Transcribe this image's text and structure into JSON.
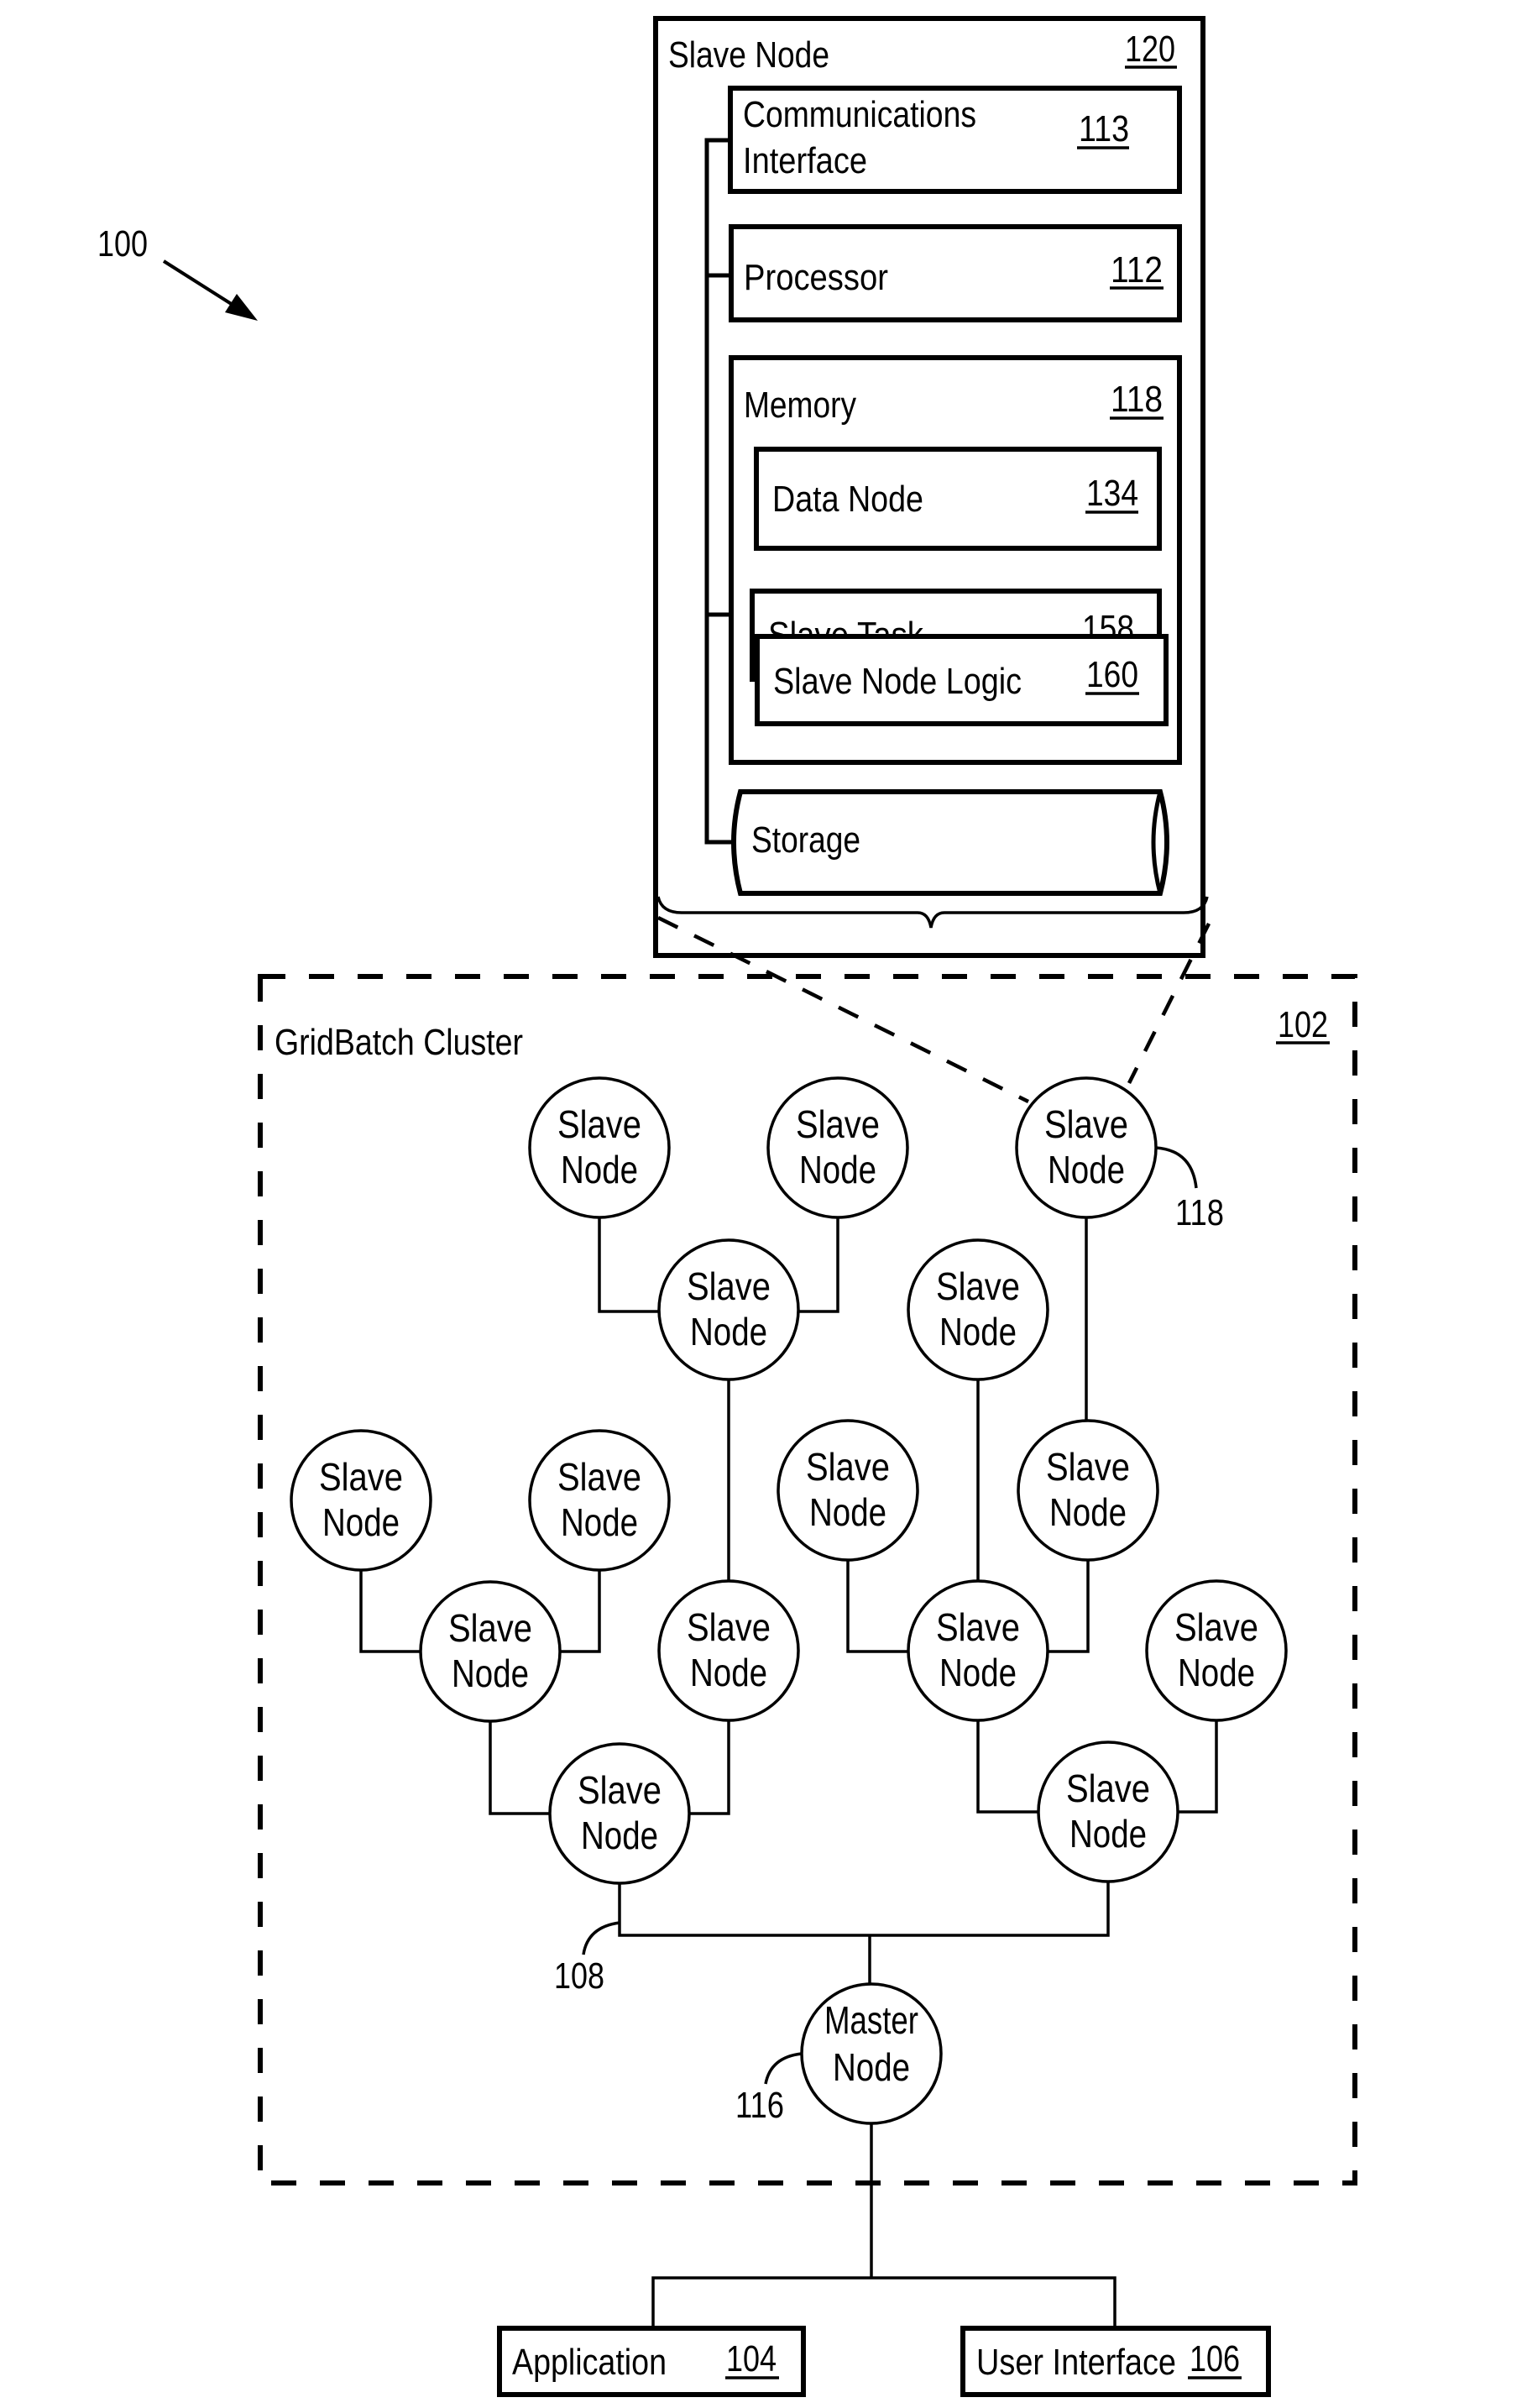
{
  "figure": {
    "reference": "100"
  },
  "slave_node_detail": {
    "title": "Slave Node",
    "ref": "120",
    "communications_interface": {
      "line1": "Communications",
      "line2": "Interface",
      "ref": "113"
    },
    "processor": {
      "label": "Processor",
      "ref": "112"
    },
    "memory": {
      "label": "Memory",
      "ref": "118",
      "data_node": {
        "label": "Data Node",
        "ref": "134"
      },
      "slave_task": {
        "label": "Slave Task",
        "ref": "158"
      },
      "slave_node_logic": {
        "label": "Slave Node Logic",
        "ref": "160"
      }
    },
    "storage": {
      "label": "Storage"
    }
  },
  "cluster": {
    "title": "GridBatch Cluster",
    "ref": "102",
    "node_line1": "Slave",
    "node_line2": "Node",
    "highlighted_node_ref": "118",
    "bus_ref": "108",
    "master": {
      "line1": "Master",
      "line2": "Node",
      "ref": "116"
    },
    "slave_node_count": 15
  },
  "external": {
    "application": {
      "label": "Application",
      "ref": "104"
    },
    "user_interface": {
      "label": "User Interface",
      "ref": "106"
    }
  }
}
